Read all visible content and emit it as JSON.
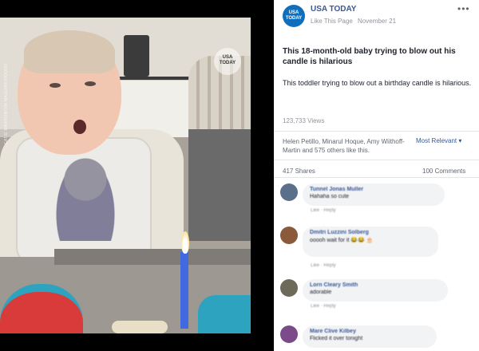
{
  "video": {
    "watermark": "USA TODAY",
    "credit": "CATIE MARRON/JIM MAGUIRE/HOUGH"
  },
  "post": {
    "page_name": "USA TODAY",
    "avatar_text": "USA TODAY",
    "like_page": "Like This Page",
    "date": "November 21",
    "title": "This 18-month-old baby trying to blow out his candle is hilarious",
    "description": "This toddler trying to blow out a birthday candle is hilarious.",
    "views": "123,733 Views"
  },
  "engagement": {
    "likers": "Helen Petillo, Minarul Hoque, Amy Wiithoff-Martin and 575 others like this.",
    "sort": "Most Relevant ▾",
    "shares": "417 Shares",
    "comments": "100 Comments"
  },
  "comments": [
    {
      "name": "Tunnel Jonas Muller",
      "text": "Hahaha so cute",
      "actions": "Like · Reply",
      "avatar_color": "#5a6f8a"
    },
    {
      "name": "Dmitri Luzzini Solberg",
      "text": "ooooh wait for it 😂😂 🎂",
      "actions": "Like · Reply",
      "avatar_color": "#8a5a3a"
    },
    {
      "name": "Lorn Cleary Smith",
      "text": "adorable",
      "actions": "Like · Reply",
      "avatar_color": "#6e6a5a"
    },
    {
      "name": "Mare Clive Kilbey",
      "text": "Flicked it over tonight",
      "actions": "Like · Reply",
      "avatar_color": "#7a4a8a"
    }
  ],
  "colors": {
    "brand_blue": "#0f6fbd",
    "link_blue": "#385898"
  }
}
